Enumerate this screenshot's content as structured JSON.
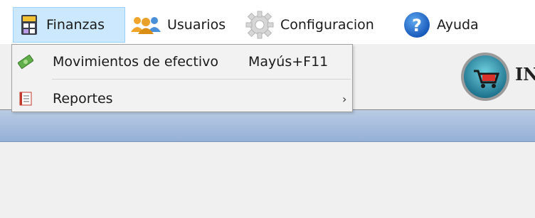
{
  "menubar": {
    "items": [
      {
        "label": "Finanzas",
        "icon": "calculator-icon"
      },
      {
        "label": "Usuarios",
        "icon": "users-icon"
      },
      {
        "label": "Configuracion",
        "icon": "gear-icon"
      },
      {
        "label": "Ayuda",
        "icon": "help-icon"
      }
    ]
  },
  "header": {
    "title_partial": "IN",
    "logo": "shopping-cart-logo"
  },
  "dropdown": {
    "items": [
      {
        "label": "Movimientos de efectivo",
        "shortcut": "Mayús+F11",
        "icon": "money-icon"
      },
      {
        "label": "Reportes",
        "submenu_arrow": "›",
        "icon": "report-icon"
      }
    ]
  },
  "colors": {
    "menu_highlight": "#cce8ff",
    "menu_highlight_border": "#99d1ff",
    "blue_bar": "#a9bfdf",
    "background": "#f0f0f0"
  }
}
